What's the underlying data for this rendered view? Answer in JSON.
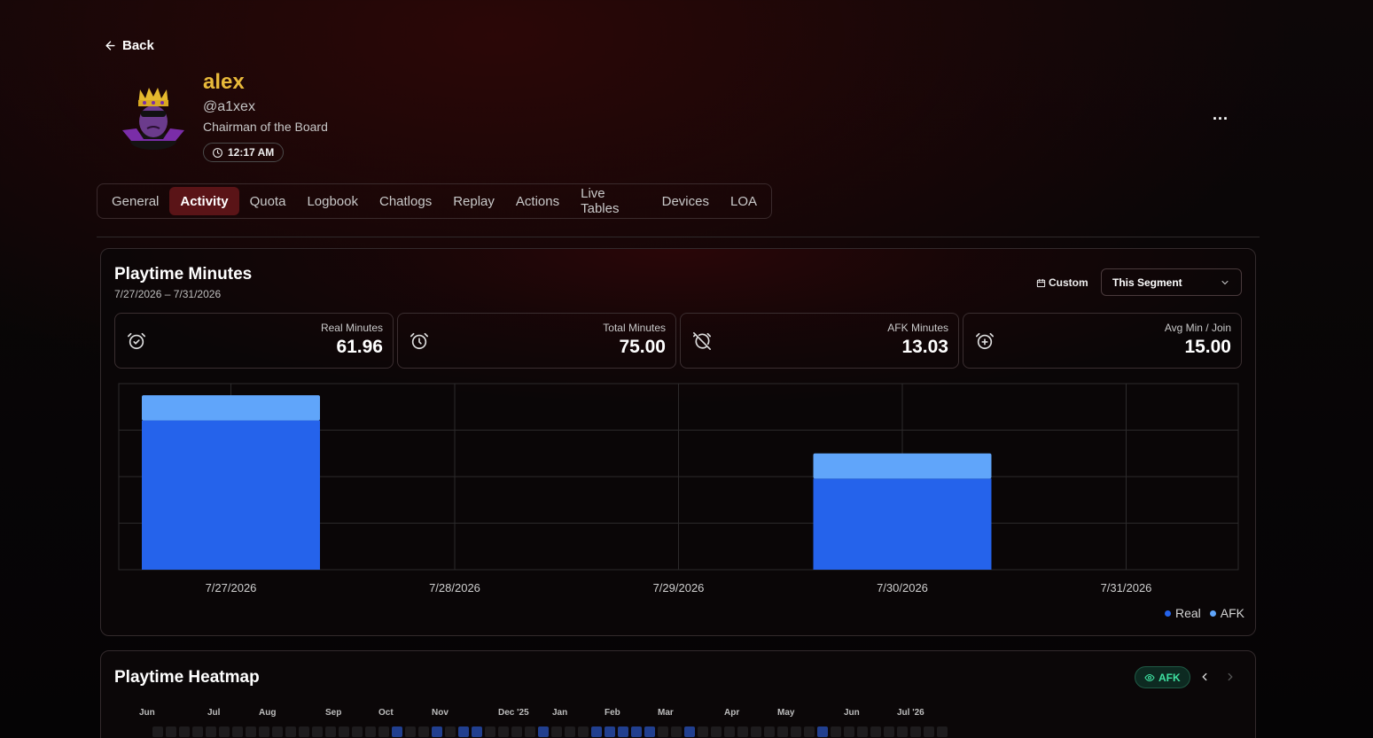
{
  "nav": {
    "back_label": "Back"
  },
  "profile": {
    "name": "alex",
    "handle": "@a1xex",
    "role": "Chairman of the Board",
    "local_time": "12:17 AM",
    "more_label": "..."
  },
  "tabs": [
    {
      "label": "General",
      "active": false
    },
    {
      "label": "Activity",
      "active": true
    },
    {
      "label": "Quota",
      "active": false
    },
    {
      "label": "Logbook",
      "active": false
    },
    {
      "label": "Chatlogs",
      "active": false
    },
    {
      "label": "Replay",
      "active": false
    },
    {
      "label": "Actions",
      "active": false
    },
    {
      "label": "Live Tables",
      "active": false
    },
    {
      "label": "Devices",
      "active": false
    },
    {
      "label": "LOA",
      "active": false
    }
  ],
  "playtime": {
    "title": "Playtime Minutes",
    "date_range": "7/27/2026 – 7/31/2026",
    "custom_label": "Custom",
    "segment_value": "This Segment",
    "stats": [
      {
        "label": "Real Minutes",
        "value": "61.96",
        "icon": "alarm-check-icon"
      },
      {
        "label": "Total Minutes",
        "value": "75.00",
        "icon": "alarm-clock-icon"
      },
      {
        "label": "AFK Minutes",
        "value": "13.03",
        "icon": "alarm-off-icon"
      },
      {
        "label": "Avg Min / Join",
        "value": "15.00",
        "icon": "alarm-plus-icon"
      }
    ]
  },
  "chart_data": {
    "type": "bar",
    "stacked": true,
    "categories": [
      "7/27/2026",
      "7/28/2026",
      "7/29/2026",
      "7/30/2026",
      "7/31/2026"
    ],
    "series": [
      {
        "name": "Real",
        "values": [
          38.5,
          0,
          0,
          23.5,
          0
        ],
        "color": "#2563eb"
      },
      {
        "name": "AFK",
        "values": [
          6.5,
          0,
          0,
          6.5,
          0
        ],
        "color": "#60a5fa"
      }
    ],
    "ylim": [
      0,
      48
    ],
    "grid": true,
    "legend": "bottom-right"
  },
  "heatmap": {
    "title": "Playtime Heatmap",
    "afk_label": "AFK",
    "months": [
      "Jun",
      "Jul",
      "Aug",
      "Sep",
      "Oct",
      "Nov",
      "Dec '25",
      "Jan",
      "Feb",
      "Mar",
      "Apr",
      "May",
      "Jun",
      "Jul '26"
    ],
    "active_cells": [
      18,
      21,
      23,
      24,
      29,
      33,
      34,
      35,
      36,
      37,
      40,
      50
    ],
    "cell_count": 60,
    "colors": {
      "empty": "#1e1c1e",
      "active": "#213f8f"
    }
  }
}
